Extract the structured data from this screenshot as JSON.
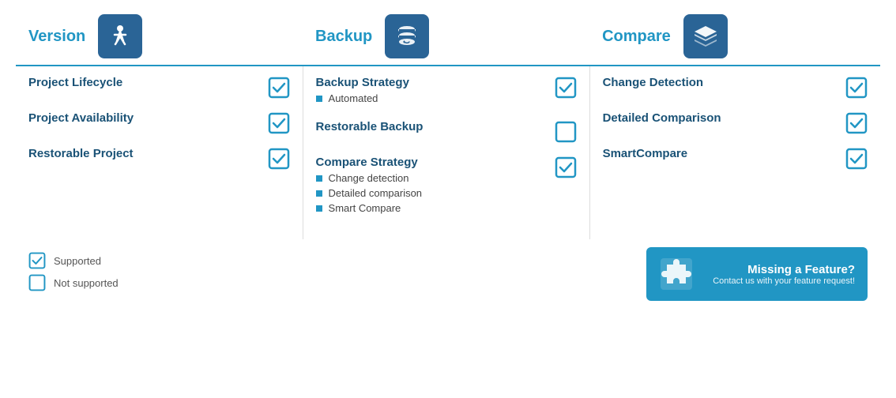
{
  "columns": {
    "version": {
      "title": "Version",
      "features": [
        {
          "label": "Project Lifecycle",
          "supported": true
        },
        {
          "label": "Project Availability",
          "supported": true
        },
        {
          "label": "Restorable Project",
          "supported": true
        }
      ]
    },
    "backup": {
      "title": "Backup",
      "features": [
        {
          "label": "Backup Strategy",
          "supported": true,
          "subitems": [
            "Automated"
          ]
        },
        {
          "label": "Restorable Backup",
          "supported": false,
          "subitems": []
        },
        {
          "label": "Compare Strategy",
          "supported": true,
          "subitems": [
            "Change detection",
            "Detailed comparison",
            "Smart Compare"
          ]
        }
      ]
    },
    "compare": {
      "title": "Compare",
      "features": [
        {
          "label": "Change Detection",
          "supported": true
        },
        {
          "label": "Detailed Comparison",
          "supported": true
        },
        {
          "label": "SmartCompare",
          "supported": true
        }
      ]
    }
  },
  "legend": {
    "supported_label": "Supported",
    "not_supported_label": "Not supported"
  },
  "missing_feature": {
    "title": "Missing a Feature?",
    "subtitle": "Contact us with your feature request!"
  }
}
